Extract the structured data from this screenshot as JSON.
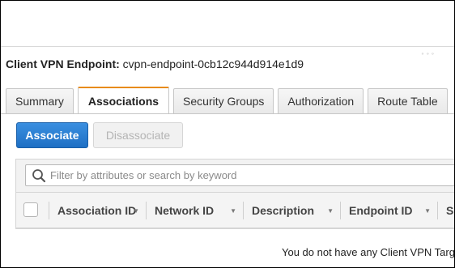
{
  "endpoint": {
    "label": "Client VPN Endpoint:",
    "id": "cvpn-endpoint-0cb12c944d914e1d9"
  },
  "tabs": [
    {
      "label": "Summary",
      "active": false
    },
    {
      "label": "Associations",
      "active": true
    },
    {
      "label": "Security Groups",
      "active": false
    },
    {
      "label": "Authorization",
      "active": false
    },
    {
      "label": "Route Table",
      "active": false
    }
  ],
  "actions": {
    "associate_label": "Associate",
    "disassociate_label": "Disassociate"
  },
  "filter": {
    "placeholder": "Filter by attributes or search by keyword",
    "value": ""
  },
  "table": {
    "columns": [
      "Association ID",
      "Network ID",
      "Description",
      "Endpoint ID",
      "S"
    ],
    "empty_message": "You do not have any Client VPN Targ"
  },
  "colors": {
    "accent": "#e88b1a",
    "primary_button": "#1e6fc4"
  }
}
